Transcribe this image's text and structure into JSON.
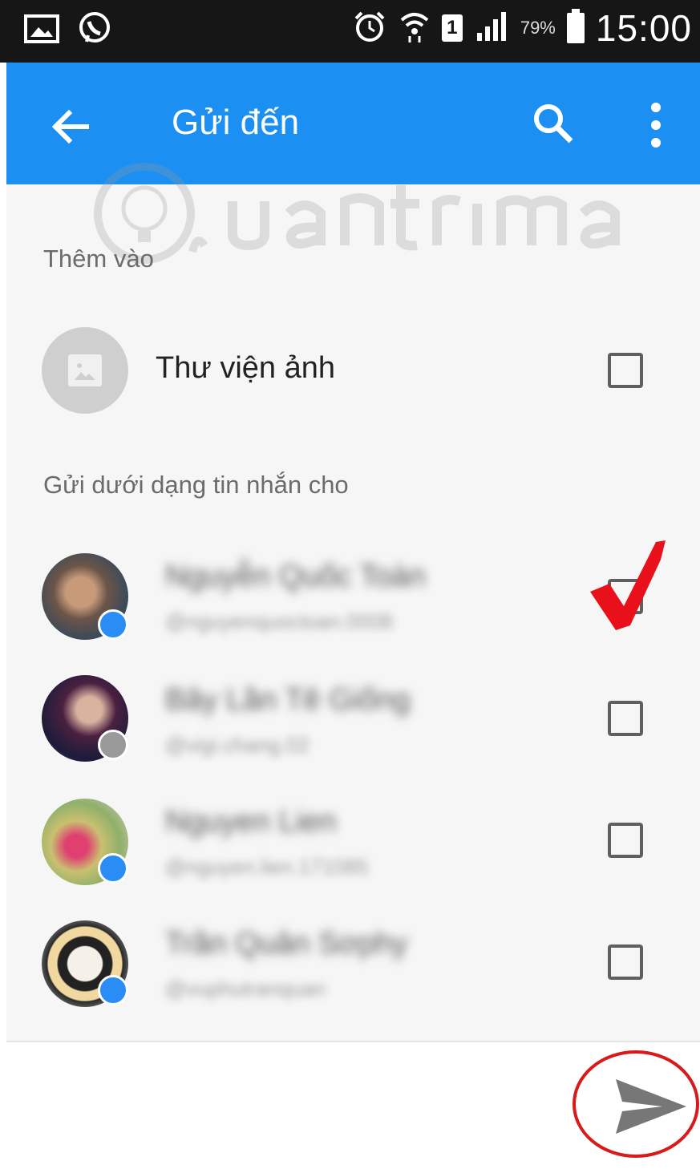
{
  "status_bar": {
    "battery_percent": "79%",
    "time": "15:00",
    "sim_slot": "1",
    "icons": [
      "gallery-icon",
      "viber-icon",
      "alarm-icon",
      "wifi-icon",
      "sim-icon",
      "signal-icon",
      "battery-icon"
    ]
  },
  "app_bar": {
    "title": "Gửi đến",
    "color": "#1b8ff2",
    "icons": [
      "back-arrow-icon",
      "search-icon",
      "more-vert-icon"
    ]
  },
  "add_section": {
    "label": "Thêm vào",
    "items": [
      {
        "title": "Thư viện ảnh",
        "checked": false,
        "icon": "image-icon"
      }
    ]
  },
  "send_section": {
    "label": "Gửi dưới dạng tin nhắn cho",
    "contacts": [
      {
        "name": "Nguyễn Quốc Toàn",
        "handle": "@nguyenquoctoan.0008",
        "checked": false
      },
      {
        "name": "Bây Lần Tê Giống",
        "handle": "@vigi.chang.02",
        "checked": false
      },
      {
        "name": "Nguyen Lien",
        "handle": "@nguyen.lien.171085",
        "checked": false
      },
      {
        "name": "Trần Quân Sơphy",
        "handle": "@vuphutranquan",
        "checked": false
      }
    ]
  },
  "annotations": {
    "checkmark_color": "#e8101a",
    "circle_color": "#d81a1a",
    "watermark": "Quantrimang"
  },
  "send_button": {
    "icon": "send-icon",
    "color": "#777777"
  }
}
